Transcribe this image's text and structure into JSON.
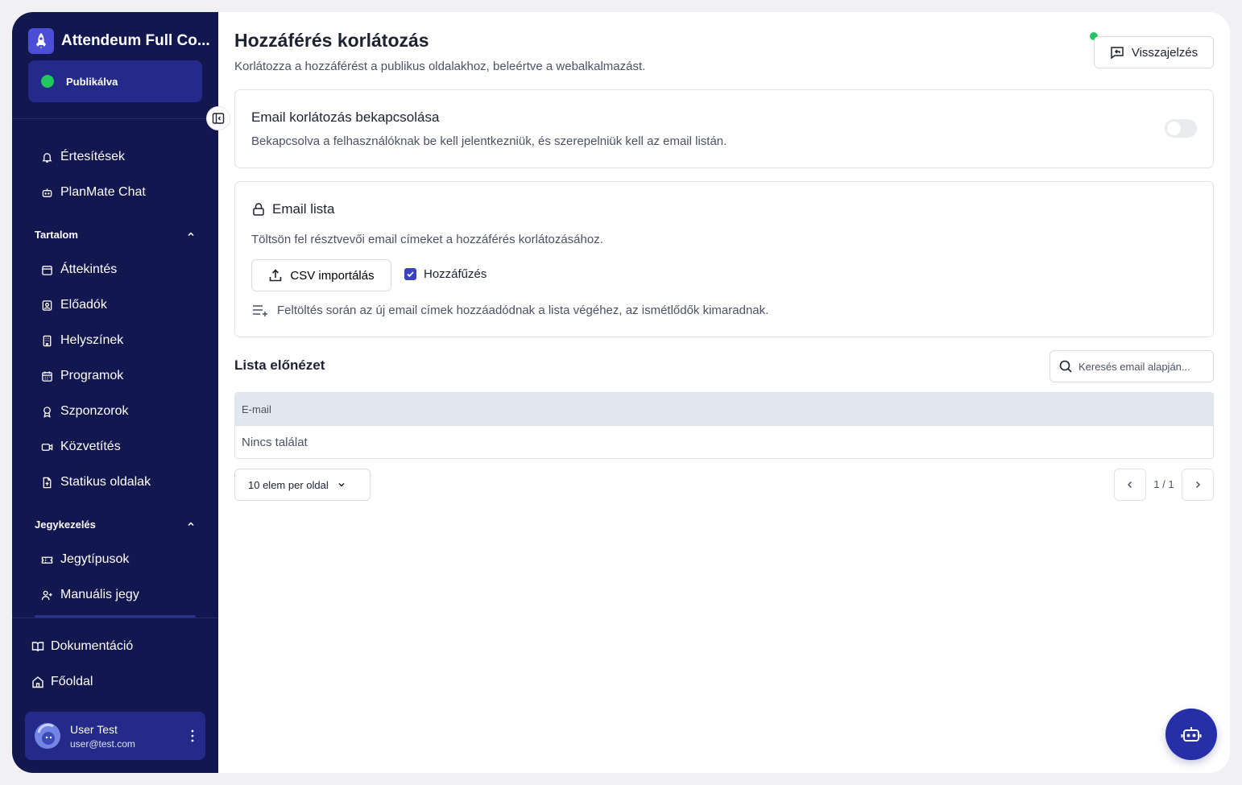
{
  "sidebar": {
    "brand_name": "Attendeum Full Co...",
    "status_label": "Publikálva",
    "nav": {
      "notifications": "Értesítések",
      "chat": "PlanMate Chat",
      "content_section": "Tartalom",
      "overview": "Áttekintés",
      "speakers": "Előadók",
      "venues": "Helyszínek",
      "programs": "Programok",
      "sponsors": "Szponzorok",
      "broadcast": "Közvetítés",
      "static_pages": "Statikus oldalak",
      "ticketing_section": "Jegykezelés",
      "ticket_types": "Jegytípusok",
      "manual_ticket": "Manuális jegy"
    },
    "bottom": {
      "docs": "Dokumentáció",
      "home": "Főoldal"
    },
    "user": {
      "name": "User Test",
      "email": "user@test.com"
    }
  },
  "header": {
    "title": "Hozzáférés korlátozás",
    "subtitle": "Korlátozza a hozzáférést a publikus oldalakhoz, beleértve a webalkalmazást.",
    "feedback_label": "Visszajelzés"
  },
  "restriction_card": {
    "title": "Email korlátozás bekapcsolása",
    "description": "Bekapcsolva a felhasználóknak be kell jelentkezniük, és szerepelniük kell az email listán.",
    "enabled": false
  },
  "email_list_card": {
    "title": "Email lista",
    "description": "Töltsön fel résztvevői email címeket a hozzáférés korlátozásához.",
    "import_label": "CSV importálás",
    "append_label": "Hozzáfűzés",
    "append_checked": true,
    "info": "Feltöltés során az új email címek hozzáadódnak a lista végéhez, az ismétlődők kimaradnak."
  },
  "preview": {
    "title": "Lista előnézet",
    "search_placeholder": "Keresés email alapján...",
    "column_email": "E-mail",
    "empty_text": "Nincs találat",
    "per_page_label": "10 elem per oldal",
    "page_info": "1 / 1"
  },
  "colors": {
    "sidebar_bg": "#13174f",
    "sidebar_active": "#232a8a",
    "status_green": "#22c55e",
    "accent": "#3942c0"
  }
}
